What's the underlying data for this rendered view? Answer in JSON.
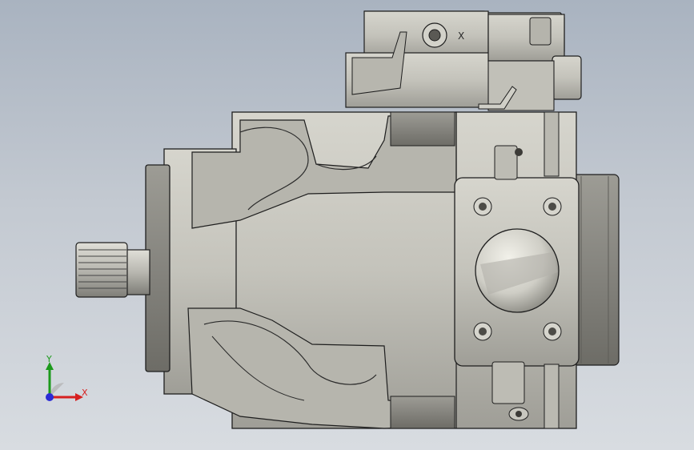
{
  "viewport": {
    "background_top": "#a9b3c0",
    "background_bottom": "#d8dce1"
  },
  "model": {
    "description_icon": "hydraulic-piston-pump-model",
    "body_color": "#c4c3bb",
    "shadow_color": "#8e8d86",
    "edge_color": "#1e1e1e",
    "part_mark": "X"
  },
  "triad": {
    "x_label": "X",
    "y_label": "Y",
    "x_color": "#d62020",
    "y_color": "#1c9a1c",
    "z_color": "#2b2bd6"
  }
}
